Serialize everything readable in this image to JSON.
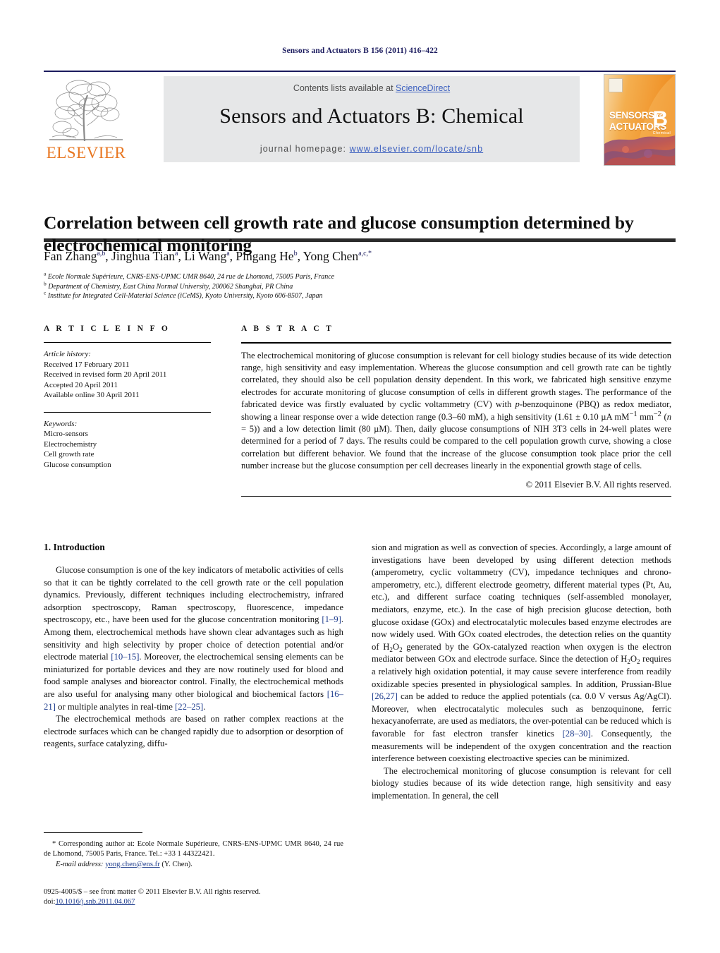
{
  "running_head": "Sensors and Actuators B 156 (2011) 416–422",
  "masthead": {
    "contents_prefix": "Contents lists available at ",
    "sciencedirect": "ScienceDirect",
    "journal_title": "Sensors and Actuators B: Chemical",
    "homepage_label": "journal homepage:",
    "homepage_url": "www.elsevier.com/locate/snb",
    "publisher": "ELSEVIER",
    "cover": {
      "line1": "SENSORS",
      "line2": "ACTUATORS",
      "and": "and",
      "series": "B",
      "subtitle": "Chemical"
    },
    "colors": {
      "link": "#3b5fbf",
      "band": "#e6e7e8",
      "elsevier_orange": "#e87722",
      "rule_navy": "#1b1b5e",
      "cover_orange": "#f3a63b"
    }
  },
  "article": {
    "title": "Correlation between cell growth rate and glucose consumption determined by electrochemical monitoring",
    "authors_html": "Fan Zhang<sup>a,b</sup>, Jinghua Tian<sup>a</sup>, Li Wang<sup>a</sup>, Pingang He<sup>b</sup>, Yong Chen<sup>a,c,*</sup>",
    "affiliations": [
      {
        "marker": "a",
        "text": "Ecole Normale Supérieure, CNRS-ENS-UPMC UMR 8640, 24 rue de Lhomond, 75005 Paris, France"
      },
      {
        "marker": "b",
        "text": "Department of Chemistry, East China Normal University, 200062 Shanghai, PR China"
      },
      {
        "marker": "c",
        "text": "Institute for Integrated Cell-Material Science (iCeMS), Kyoto University, Kyoto 606-8507, Japan"
      }
    ]
  },
  "article_info": {
    "heading": "A R T I C L E   I N F O",
    "history_label": "Article history:",
    "history": [
      "Received 17 February 2011",
      "Received in revised form 20 April 2011",
      "Accepted 20 April 2011",
      "Available online 30 April 2011"
    ],
    "keywords_label": "Keywords:",
    "keywords": [
      "Micro-sensors",
      "Electrochemistry",
      "Cell growth rate",
      "Glucose consumption"
    ]
  },
  "abstract": {
    "heading": "A B S T R A C T",
    "text_html": "The electrochemical monitoring of glucose consumption is relevant for cell biology studies because of its wide detection range, high sensitivity and easy implementation. Whereas the glucose consumption and cell growth rate can be tightly correlated, they should also be cell population density dependent. In this work, we fabricated high sensitive enzyme electrodes for accurate monitoring of glucose consumption of cells in different growth stages. The performance of the fabricated device was firstly evaluated by cyclic voltammetry (CV) with <i>p</i>-benzoquinone (PBQ) as redox mediator, showing a linear response over a wide detection range (0.3–60 mM), a high sensitivity (1.61 ± 0.10 &#181;A mM<sup>&#8722;1</sup> mm<sup>&#8722;2</sup> (<i>n</i> = 5)) and a low detection limit (80 &#181;M). Then, daily glucose consumptions of NIH 3T3 cells in 24-well plates were determined for a period of 7 days. The results could be compared to the cell population growth curve, showing a close correlation but different behavior. We found that the increase of the glucose consumption took place prior the cell number increase but the glucose consumption per cell decreases linearly in the exponential growth stage of cells.",
    "copyright": "© 2011 Elsevier B.V. All rights reserved."
  },
  "body": {
    "section_number_title": "1.  Introduction",
    "left_paragraphs_html": [
      "Glucose consumption is one of the key indicators of metabolic activities of cells so that it can be tightly correlated to the cell growth rate or the cell population dynamics. Previously, different techniques including electrochemistry, infrared adsorption spectroscopy, Raman spectroscopy, fluorescence, impedance spectroscopy, etc., have been used for the glucose concentration monitoring <span class=\"ref\">[1–9]</span>. Among them, electrochemical methods have shown clear advantages such as high sensitivity and high selectivity by proper choice of detection potential and/or electrode material <span class=\"ref\">[10–15]</span>. Moreover, the electrochemical sensing elements can be miniaturized for portable devices and they are now routinely used for blood and food sample analyses and bioreactor control. Finally, the electrochemical methods are also useful for analysing many other biological and biochemical factors <span class=\"ref\">[16–21]</span> or multiple analytes in real-time <span class=\"ref\">[22–25]</span>.",
      "The electrochemical methods are based on rather complex reactions at the electrode surfaces which can be changed rapidly due to adsorption or desorption of reagents, surface catalyzing, diffu-"
    ],
    "right_paragraphs_html": [
      "sion and migration as well as convection of species. Accordingly, a large amount of investigations have been developed by using different detection methods (amperometry, cyclic voltammetry (CV), impedance techniques and chrono-amperometry, etc.), different electrode geometry, different material types (Pt, Au, etc.), and different surface coating techniques (self-assembled monolayer, mediators, enzyme, etc.). In the case of high precision glucose detection, both glucose oxidase (GOx) and electrocatalytic molecules based enzyme electrodes are now widely used. With GOx coated electrodes, the detection relies on the quantity of H<sub>2</sub>O<sub>2</sub> generated by the GOx-catalyzed reaction when oxygen is the electron mediator between GOx and electrode surface. Since the detection of H<sub>2</sub>O<sub>2</sub> requires a relatively high oxidation potential, it may cause severe interference from readily oxidizable species presented in physiological samples. In addition, Prussian-Blue <span class=\"ref\">[26,27]</span> can be added to reduce the applied potentials (ca. 0.0 V versus Ag/AgCl). Moreover, when electrocatalytic molecules such as benzoquinone, ferric hexacyanoferrate, are used as mediators, the over-potential can be reduced which is favorable for fast electron transfer kinetics <span class=\"ref\">[28–30]</span>. Consequently, the measurements will be independent of the oxygen concentration and the reaction interference between coexisting electroactive species can be minimized.",
      "The electrochemical monitoring of glucose consumption is relevant for cell biology studies because of its wide detection range, high sensitivity and easy implementation. In general, the cell"
    ]
  },
  "footnotes": {
    "corresponding_html": "* Corresponding author at: Ecole Normale Supérieure, CNRS-ENS-UPMC UMR 8640, 24 rue de Lhomond, 75005 Paris, France. Tel.: +33 1 44322421.",
    "email_label": "E-mail address:",
    "email": "yong.chen@ens.fr",
    "email_suffix": "(Y. Chen).",
    "imprint_line1": "0925-4005/$ – see front matter © 2011 Elsevier B.V. All rights reserved.",
    "doi_label": "doi:",
    "doi_value": "10.1016/j.snb.2011.04.067"
  }
}
